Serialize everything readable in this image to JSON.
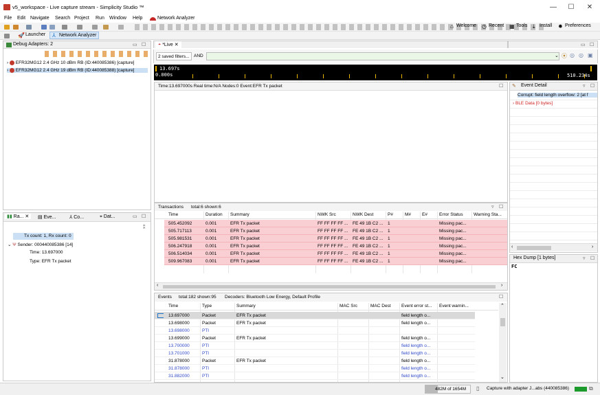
{
  "window": {
    "title": "v5_workspace - Live capture stream - Simplicity Studio ™",
    "minimize": "—",
    "maximize": "☐",
    "close": "✕"
  },
  "menu": [
    "File",
    "Edit",
    "Navigate",
    "Search",
    "Project",
    "Run",
    "Window",
    "Help"
  ],
  "network_analyzer_label": "Network Analyzer",
  "toolbar": {
    "welcome": "Welcome",
    "recent": "Recent",
    "tools": "Tools",
    "install": "Install",
    "preferences": "Preferences"
  },
  "perspectives": {
    "launcher": "Launcher",
    "network_analyzer": "Network Analyzer"
  },
  "debug_adapters": {
    "tab_label": "Debug Adapters: 2",
    "items": [
      "EFR32MG12 2.4 GHz 10 dBm RB (ID:440085386) [capture]",
      "EFR32MG12 2.4 GHz 19 dBm RB (ID:440085388) [capture]"
    ]
  },
  "left_bottom": {
    "tabs": [
      "Ra...",
      "Eve...",
      "Co...",
      "Dat..."
    ],
    "count_line": "Tx count: 1, Rx count: 0",
    "sender": "Sender: 000440085386 [14]",
    "time": "Time: 13.697000",
    "type": "Type: EFR Tx packet"
  },
  "live": {
    "tab_label": "*Live",
    "filter_label": "2 saved filters...",
    "filter_and": "AND",
    "timeline_left": "13.697s",
    "timeline_left2": "0.000s",
    "timeline_right": "510.234s",
    "info_line": "Time:13.697000s   Real time:N/A   Nodes:0   Event:EFR Tx packet"
  },
  "transactions": {
    "header": "Transactions",
    "totals": "total:6 shown:6",
    "columns": [
      "Time",
      "Duration",
      "Summary",
      "NWK Src",
      "NWK Dest",
      "P#",
      "M#",
      "E#",
      "Error Status",
      "Warning Sta..."
    ],
    "rows": [
      [
        "505.452092",
        "0.001",
        "EFR Tx packet",
        "FF FF FF FF ...",
        "FE 49 1B C2 ...",
        "1",
        "",
        "",
        "Missing pac...",
        ""
      ],
      [
        "505.717113",
        "0.001",
        "EFR Tx packet",
        "FF FF FF FF ...",
        "FE 49 1B C2 ...",
        "1",
        "",
        "",
        "Missing pac...",
        ""
      ],
      [
        "505.981531",
        "0.001",
        "EFR Tx packet",
        "FF FF FF FF ...",
        "FE 49 1B C2 ...",
        "1",
        "",
        "",
        "Missing pac...",
        ""
      ],
      [
        "506.247918",
        "0.001",
        "EFR Tx packet",
        "FF FF FF FF ...",
        "FE 49 1B C2 ...",
        "1",
        "",
        "",
        "Missing pac...",
        ""
      ],
      [
        "506.514034",
        "0.001",
        "EFR Tx packet",
        "FF FF FF FF ...",
        "FE 49 1B C2 ...",
        "1",
        "",
        "",
        "Missing pac...",
        ""
      ],
      [
        "509.967083",
        "0.001",
        "EFR Tx packet",
        "FF FF FF FF ...",
        "FE 49 1B C2 ...",
        "1",
        "",
        "",
        "Missing pac...",
        ""
      ]
    ]
  },
  "events": {
    "header": "Events",
    "totals": "total:182 shown:95",
    "decoders": "Decoders: Bluetooth Low Energy, Default Profile",
    "columns": [
      "Time",
      "Type",
      "Summary",
      "MAC Src",
      "MAC Dest",
      "Event error st...",
      "Event warnin..."
    ],
    "rows": [
      [
        "13.697000",
        "Packet",
        "EFR Tx packet",
        "",
        "",
        "field length o...",
        ""
      ],
      [
        "13.698000",
        "Packet",
        "EFR Tx packet",
        "",
        "",
        "field length o...",
        ""
      ],
      [
        "13.698000",
        "PTI",
        "",
        "",
        "",
        "",
        ""
      ],
      [
        "13.699000",
        "Packet",
        "EFR Tx packet",
        "",
        "",
        "field length o...",
        ""
      ],
      [
        "13.700000",
        "PTI",
        "",
        "",
        "",
        "field length o...",
        ""
      ],
      [
        "13.701000",
        "PTI",
        "",
        "",
        "",
        "field length o...",
        ""
      ],
      [
        "31.878000",
        "Packet",
        "EFR Tx packet",
        "",
        "",
        "field length o...",
        ""
      ],
      [
        "31.878000",
        "PTI",
        "",
        "",
        "",
        "field length o...",
        ""
      ],
      [
        "31.882000",
        "PTI",
        "",
        "",
        "",
        "field length o...",
        ""
      ]
    ]
  },
  "event_detail": {
    "tab_label": "Event Detail",
    "line1": "Corrupt: field length overflow: 2 [at f",
    "line2": "BLE Data [0 bytes]"
  },
  "hex_dump": {
    "tab_label": "Hex Dump [1 bytes]",
    "content": "FC"
  },
  "status": {
    "memory": "482M of 1654M",
    "capture": "Capture with adapter J...abs (440085386)"
  },
  "colors": {
    "error_row": "#f9cfd3",
    "pti_text": "#2f49c6",
    "accent": "#1a73c8"
  }
}
